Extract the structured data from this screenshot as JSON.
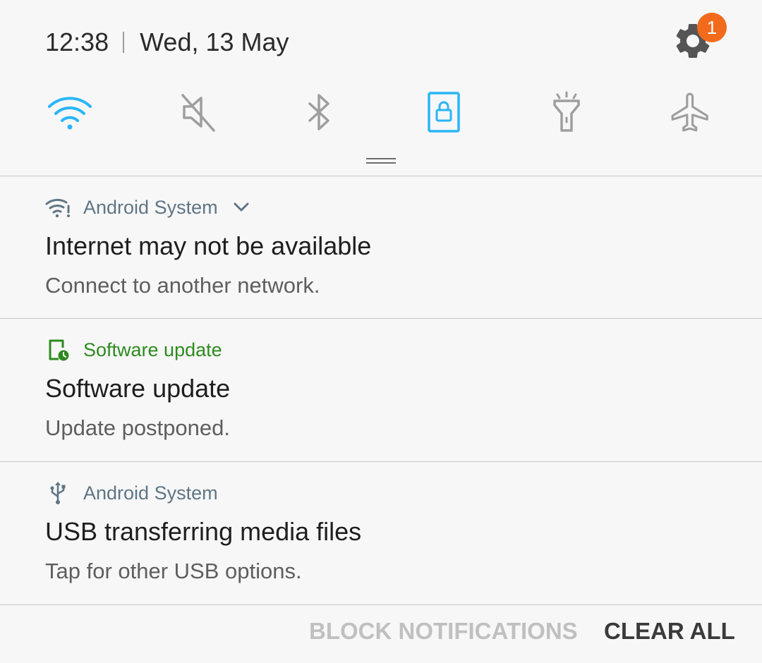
{
  "status": {
    "time": "12:38",
    "date": "Wed, 13 May",
    "settings_badge": "1",
    "badge_color": "#f26b1d"
  },
  "quick_settings": [
    {
      "icon": "wifi-icon",
      "state": "on"
    },
    {
      "icon": "sound-mute-icon",
      "state": "off"
    },
    {
      "icon": "bluetooth-icon",
      "state": "off"
    },
    {
      "icon": "screen-lock-icon",
      "state": "on"
    },
    {
      "icon": "flashlight-icon",
      "state": "off"
    },
    {
      "icon": "airplane-icon",
      "state": "off"
    }
  ],
  "accent_color": "#29b6f6",
  "notifications": [
    {
      "app": "Android System",
      "icon": "wifi-warning-icon",
      "title": "Internet may not be available",
      "body": "Connect to another network."
    },
    {
      "app": "Software update",
      "icon": "software-update-icon",
      "title": "Software update",
      "body": "Update postponed."
    },
    {
      "app": "Android System",
      "icon": "usb-icon",
      "title": "USB transferring media files",
      "body": "Tap for other USB options."
    }
  ],
  "footer": {
    "block_label": "BLOCK NOTIFICATIONS",
    "clear_label": "CLEAR ALL"
  }
}
